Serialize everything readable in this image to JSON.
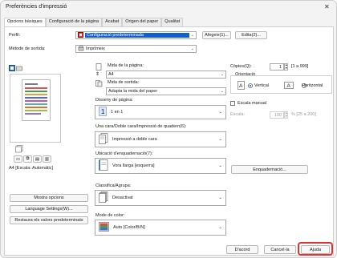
{
  "window": {
    "title": "Preferències d'impressió"
  },
  "tabs": [
    "Opcions bàsiques",
    "Configuració de la pàgina",
    "Acabat",
    "Origen del paper",
    "Qualitat"
  ],
  "profile": {
    "label": "Perfil:",
    "value": "Configuració predeterminada",
    "add_button": "Afegeix(1)...",
    "edit_button": "Edita(2)..."
  },
  "output_method": {
    "label": "Mètode de sortida:",
    "value": "Imprimeix"
  },
  "page_size": {
    "label": "Mida de la pàgina:",
    "value": "A4"
  },
  "output_size": {
    "label": "Mida de sortida:",
    "value": "Adapta la mida del paper"
  },
  "copies": {
    "label": "Còpies(Q):",
    "value": "1",
    "range": "[1 a 999]"
  },
  "orientation": {
    "label": "Orientació",
    "portrait": "Vertical",
    "landscape": "Horitzontal",
    "selected": "portrait"
  },
  "manual_scale": {
    "label": "Escala manual",
    "checked": false
  },
  "scale": {
    "label": "Escala:",
    "value": "100",
    "range": "% [25 a 200]"
  },
  "page_layout": {
    "label": "Disseny de pàgina:",
    "value": "1 en 1"
  },
  "duplex": {
    "label": "Una cara/Doble cara/Impressió de quadern(6):",
    "value": "Impressió a doble cara"
  },
  "binding": {
    "label": "Ubicació d'enquadernació(7):",
    "value": "Vora llarga [esquerra]",
    "button": "Enquadernació..."
  },
  "collate": {
    "label": "Classifica/Agrupa:",
    "value": "Desactivat"
  },
  "color_mode": {
    "label": "Mode de color:",
    "value": "Auto [Color/B/N]"
  },
  "preview": {
    "caption": "A4 [Escala: Automàtic]"
  },
  "left_buttons": [
    "Mostra opcions",
    "Language Settings(W)...",
    "Restaura els valors predeterminats"
  ],
  "footer": {
    "ok": "D'acord",
    "cancel": "Cancel·la",
    "help": "Ajuda"
  }
}
